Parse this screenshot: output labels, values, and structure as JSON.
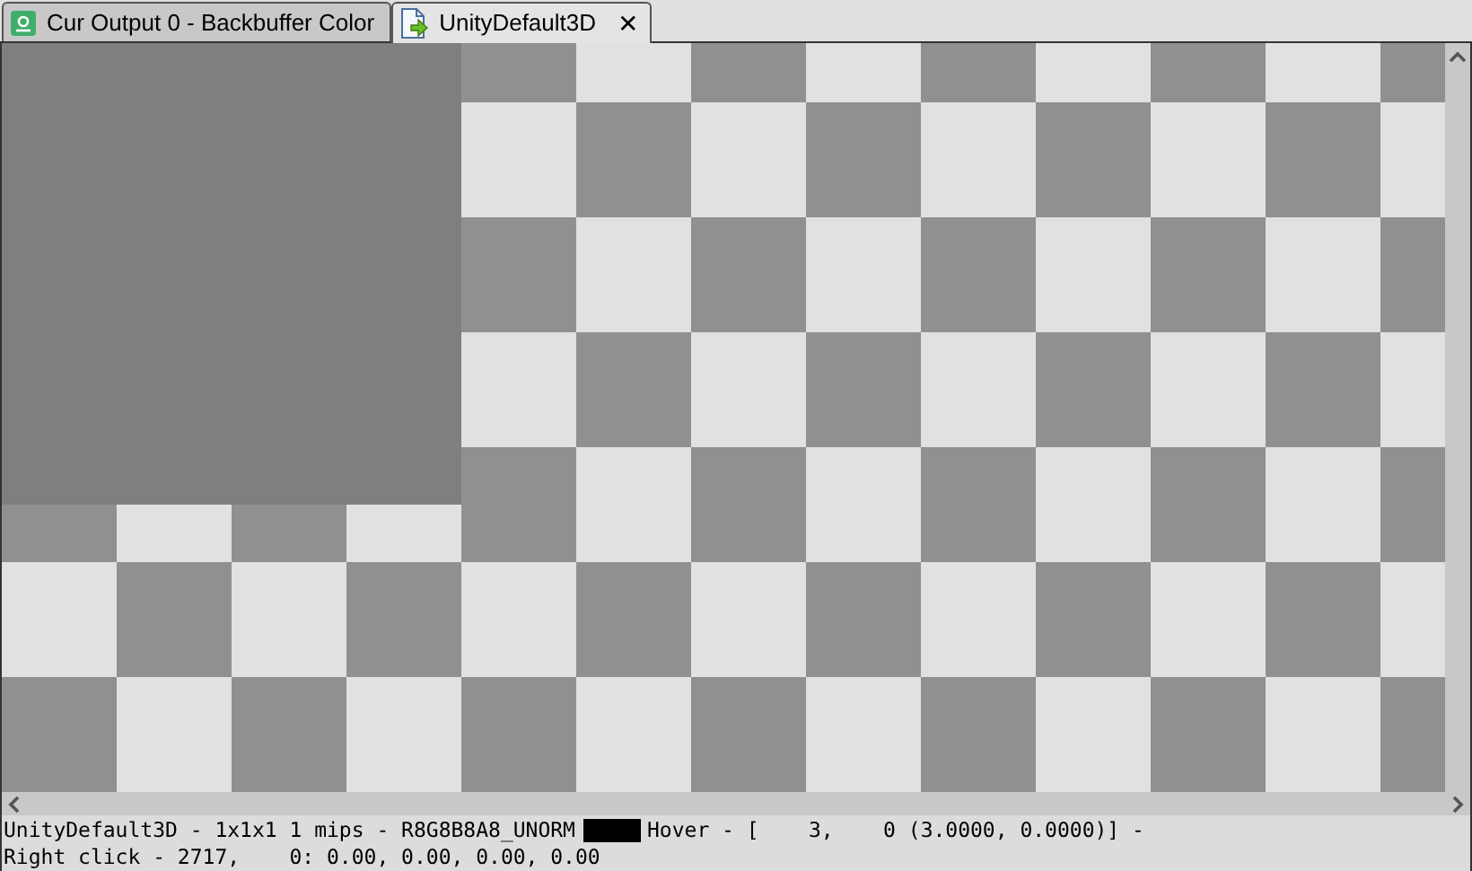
{
  "tabs": [
    {
      "label": "Cur Output 0 - Backbuffer Color",
      "kind": "output",
      "selected": false,
      "closable": false
    },
    {
      "label": "UnityDefault3D",
      "kind": "document",
      "selected": true,
      "closable": true
    }
  ],
  "close_glyph": "✕",
  "status_bar": {
    "line_1_start": "UnityDefault3D - 1x1x1 1 mips - R8G8B8A8_UNORM",
    "swatch": {
      "color": "#000000"
    },
    "line_1_end": "Hover - [    3,    0 (3.0000, 0.0000)] -",
    "line_2": "Right click - 2717,    0: 0.00, 0.00, 0.00, 0.00"
  }
}
